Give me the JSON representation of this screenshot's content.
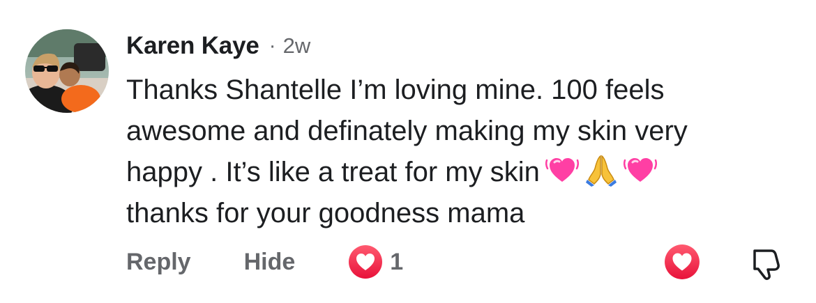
{
  "comment": {
    "author": "Karen Kaye",
    "separator": "·",
    "time": "2w",
    "body_lines": [
      "Thanks Shantelle I’m loving mine. 100 feels",
      "awesome and definately making my skin very",
      "happy . It’s like a treat for my skin",
      "thanks for your goodness mama"
    ],
    "emojis": [
      "beating-heart",
      "folded-hands",
      "beating-heart"
    ]
  },
  "actions": {
    "reply_label": "Reply",
    "hide_label": "Hide",
    "reaction_count": "1"
  },
  "icons": {
    "reaction": "heart-icon",
    "react_button": "heart-icon",
    "dislike": "thumbs-down-icon"
  },
  "colors": {
    "text": "#1c1e21",
    "muted": "#65676b",
    "heart_red": "#f0284a",
    "emoji_pink": "#ff3fa4"
  }
}
